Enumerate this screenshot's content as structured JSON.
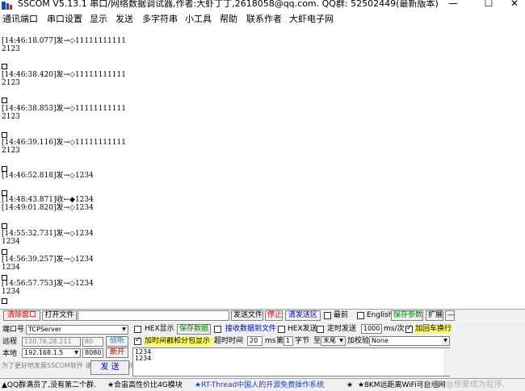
{
  "window": {
    "title": "SSCOM V5.13.1 串口/网络数据调试器,作者:大虾丁丁,2618058@qq.com. QQ群: 52502449(最新版本)",
    "min_glyph": "—",
    "max_glyph": "☐",
    "close_glyph": "✕"
  },
  "menu": {
    "items": [
      "通讯端口",
      "串口设置",
      "显示",
      "发送",
      "多字符串",
      "小工具",
      "帮助",
      "联系作者",
      "大虾电子网"
    ]
  },
  "log": {
    "lines": [
      {
        "text": "[14:46:18.077]发→◇11111111111",
        "box": false
      },
      {
        "text": "2123",
        "box": false
      },
      {
        "text": "",
        "box": true
      },
      {
        "text": "[14:46:38.420]发→◇11111111111",
        "box": false
      },
      {
        "text": "2123",
        "box": false
      },
      {
        "text": "",
        "box": true
      },
      {
        "text": "[14:46:38.853]发→◇11111111111",
        "box": false
      },
      {
        "text": "2123",
        "box": false
      },
      {
        "text": "",
        "box": true
      },
      {
        "text": "[14:46:39.116]发→◇11111111111",
        "box": false
      },
      {
        "text": "2123",
        "box": false
      },
      {
        "text": "",
        "box": true
      },
      {
        "text": "[14:46:52.818]发→◇1234",
        "box": false
      },
      {
        "text": "",
        "box": true
      },
      {
        "text": "[14:48:43.871]收←◆1234",
        "box": false
      },
      {
        "text": "[14:49:01.820]发→◇1234",
        "box": false
      },
      {
        "text": "",
        "box": true
      },
      {
        "text": "[14:55:32.731]发→◇1234",
        "box": false
      },
      {
        "text": "1234",
        "box": false
      },
      {
        "text": "",
        "box": true
      },
      {
        "text": "[14:56:39.257]发→◇1234",
        "box": false
      },
      {
        "text": "1234",
        "box": false
      },
      {
        "text": "",
        "box": true
      },
      {
        "text": "[14:56:57.753]发→◇1234",
        "box": false
      },
      {
        "text": "1234",
        "box": false
      },
      {
        "text": "",
        "box": true
      }
    ]
  },
  "toolbar": {
    "clear_window": "清除窗口",
    "open_file": "打开文件",
    "send_file": "发送文件",
    "stop": "停止",
    "clear_send": "清发送区",
    "top_label": "最前",
    "english_label": "English",
    "save_params": "保存参数",
    "expand": "扩展",
    "dash": "—"
  },
  "settings": {
    "port_label": "端口号",
    "port_value": "TCPServer",
    "hex_display": "HEX显示",
    "save_data": "保存数据",
    "recv_to_file": "接收数据到文件",
    "hex_send": "HEX发送",
    "timed_send": "定时发送",
    "interval_value": "1000",
    "interval_unit": "ms/次",
    "add_newline": "加回车换行",
    "remote_label": "远程",
    "remote_ip": "120.76.28.211",
    "remote_port": "80",
    "listen_button": "侦听",
    "timestamp_packet": "加时间戳和分包显示",
    "timeout_label": "超时时间",
    "timeout_value": "20",
    "ms_label": "ms",
    "nth_label": "第",
    "byte_value": "1",
    "byte_label": "字节",
    "to_label": "至",
    "end_value": "末尾",
    "checksum_label": "加校验",
    "checksum_value": "None",
    "local_label": "本地",
    "local_ip": "192.168.1.5",
    "local_port": "8080",
    "disconnect_button": "断开",
    "send_text": "1234\n1234",
    "send_button": "发 送",
    "tip": "为了更好地发展SSCOM软件\n请您注册嘉立创P结尾客户"
  },
  "status": {
    "seg1": "▲QQ群满员了,没有第二个群.",
    "seg2": "★合宙高性价比4G模块",
    "seg3": "★RT-Thread中国人的开源免费操作系统",
    "seg4": "★",
    "seg5": "★8KM远距离WiFi可自组网"
  },
  "watermark": "CSDN @想要成为程序."
}
